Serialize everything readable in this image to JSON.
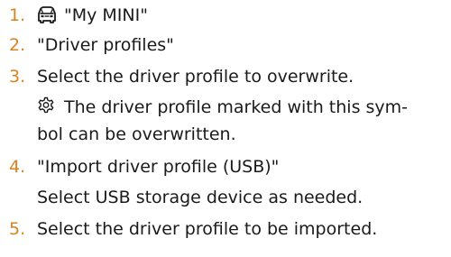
{
  "steps": [
    {
      "number": "1.",
      "text": "\"My MINI\"",
      "icon": "car-icon"
    },
    {
      "number": "2.",
      "text": "\"Driver profiles\""
    },
    {
      "number": "3.",
      "text": "Select the driver profile to overwrite."
    },
    {
      "number": "4.",
      "text": "\"Import driver profile (USB)\""
    },
    {
      "number": "5.",
      "text": "Select the driver profile to be imported."
    }
  ],
  "notes": {
    "gear_note_line1": "The driver profile marked with this sym-",
    "gear_note_line2": "bol can be overwritten.",
    "gear_icon": "gear-icon",
    "usb_note": "Select USB storage device as needed."
  },
  "colors": {
    "step_number": "#d9821e",
    "text": "#1a1a1a"
  }
}
